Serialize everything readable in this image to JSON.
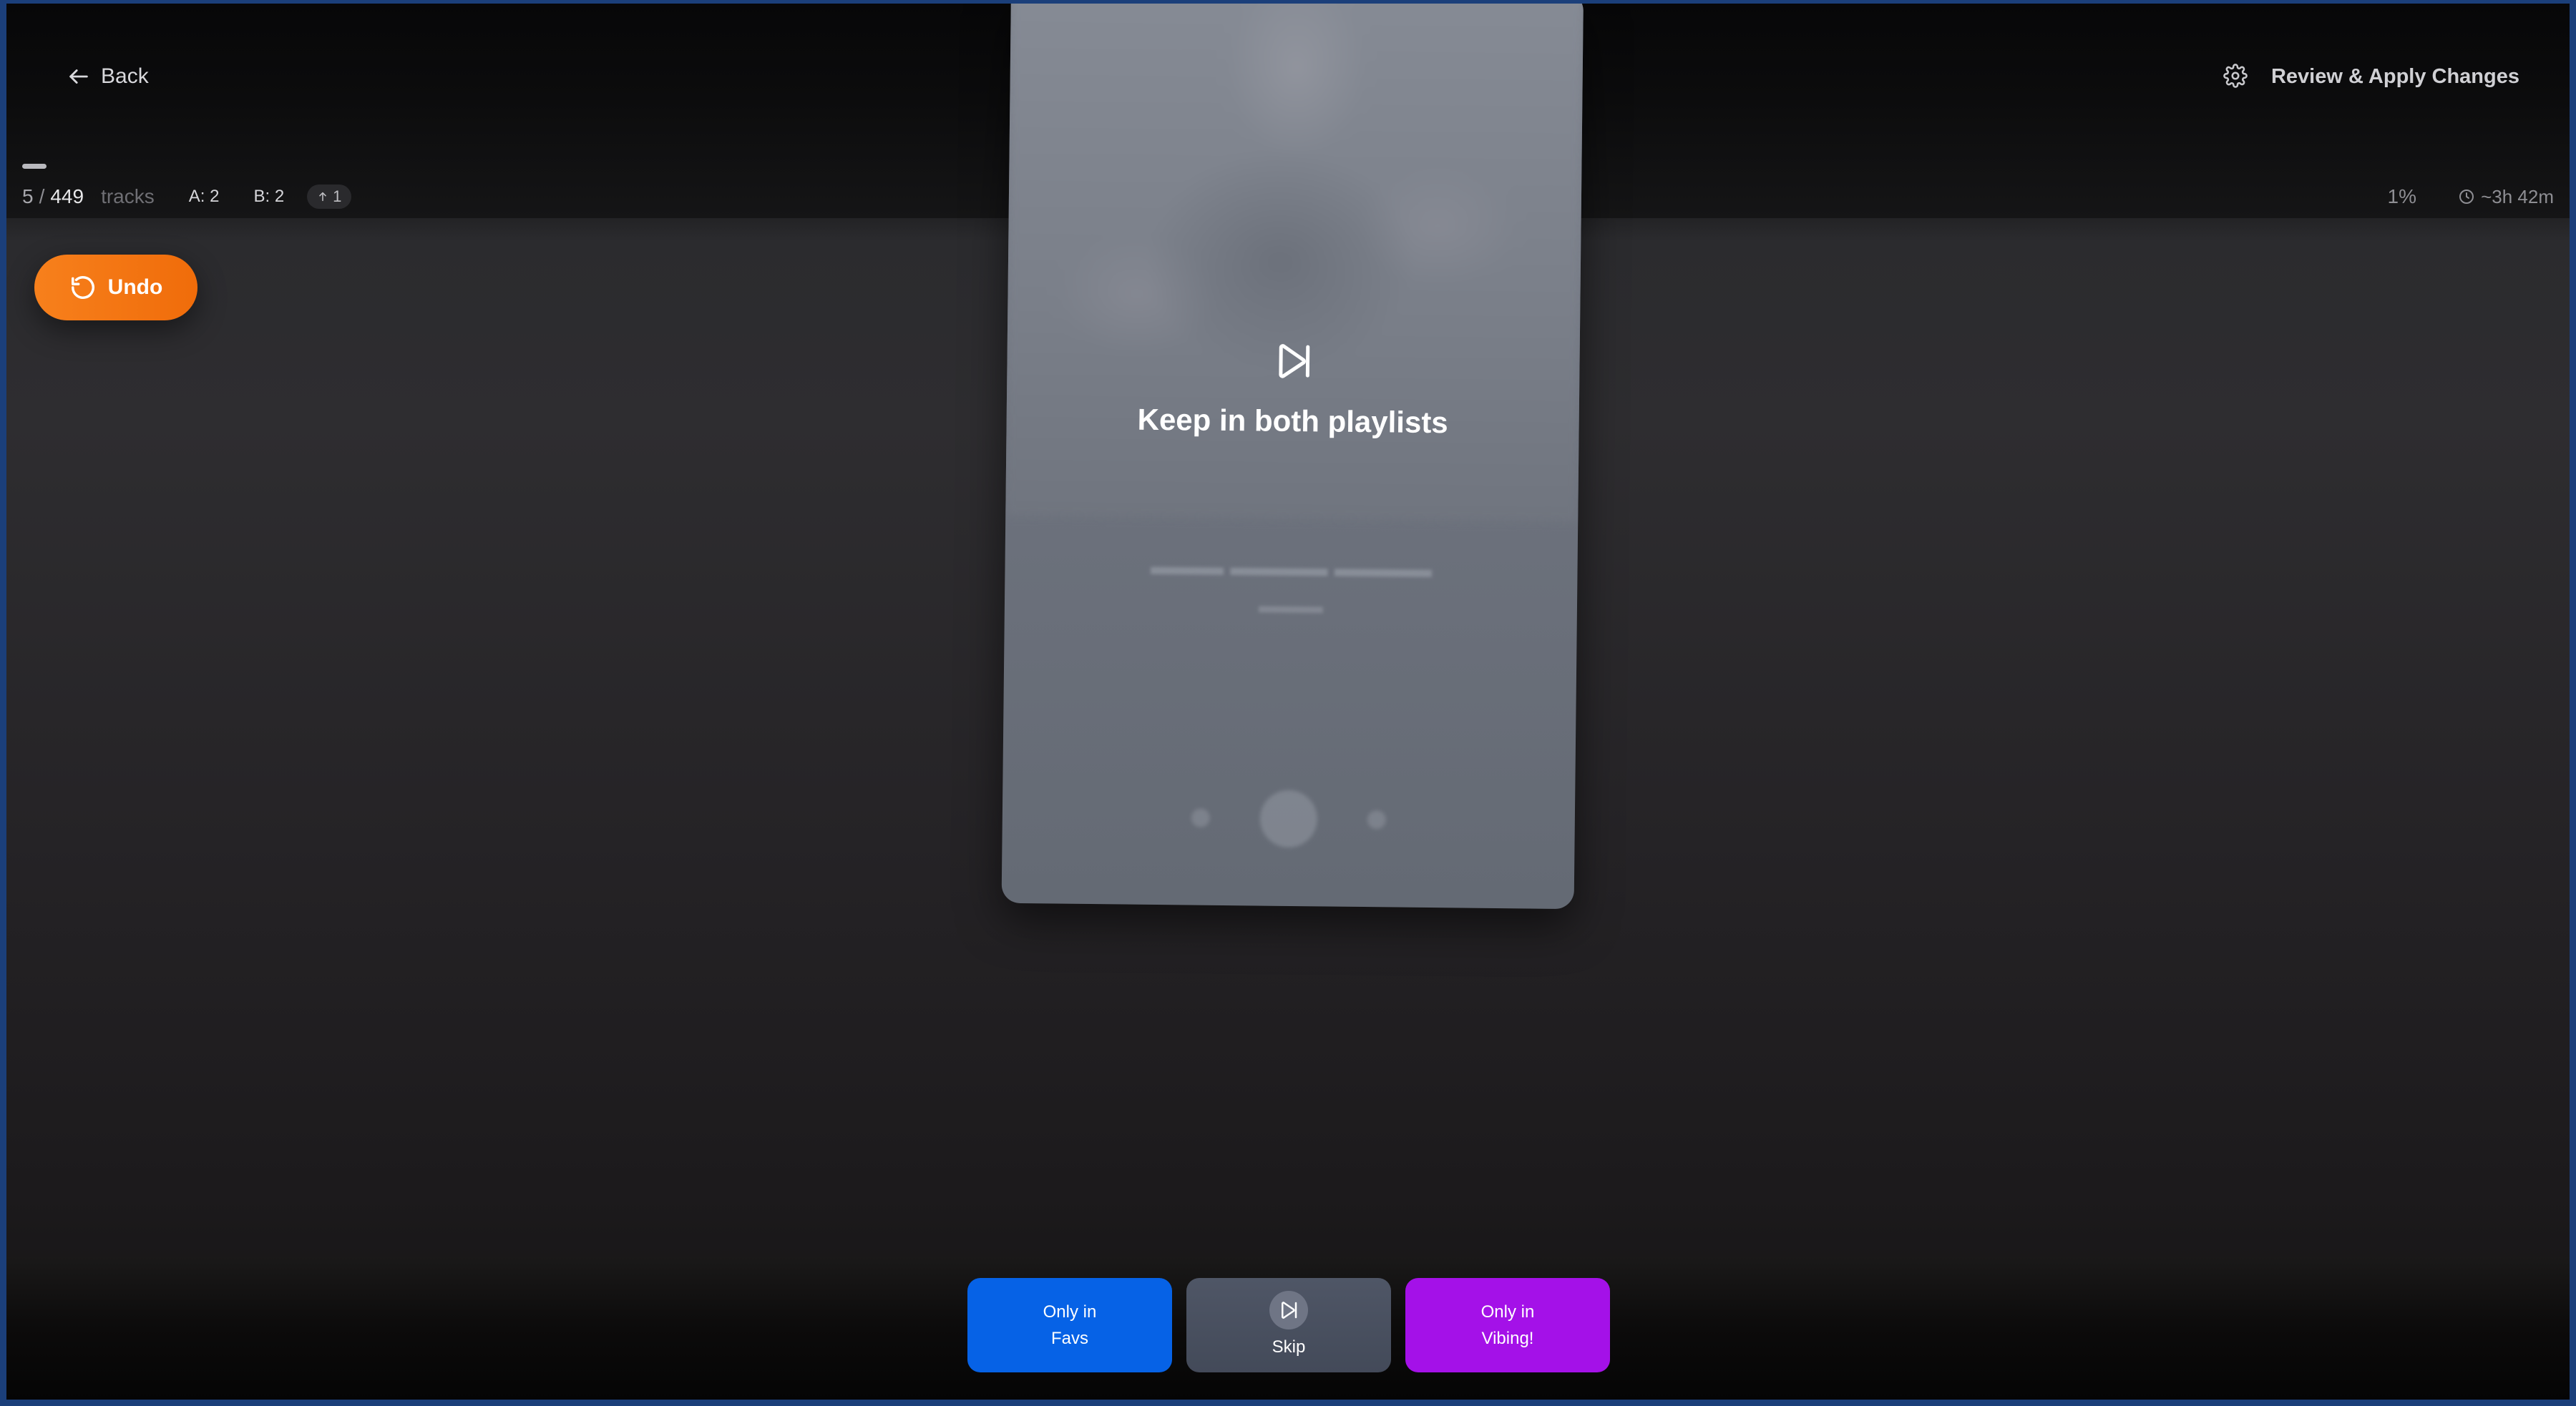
{
  "header": {
    "back_label": "Back",
    "review_label": "Review & Apply Changes"
  },
  "progress": {
    "current": "5",
    "separator": "/",
    "total": "449",
    "unit": "tracks",
    "count_a": "A: 2",
    "count_b": "B: 2",
    "up_count": "1",
    "percent": "1%",
    "eta": "~3h 42m",
    "fraction": 0.011
  },
  "undo": {
    "label": "Undo"
  },
  "card": {
    "overlay_label": "Keep in both playlists",
    "overlay_icon": "skip-forward-icon"
  },
  "actions": {
    "left_line1": "Only in",
    "left_line2": "Favs",
    "skip_label": "Skip",
    "right_line1": "Only in",
    "right_line2": "Vibing!"
  },
  "colors": {
    "undo": "#f7801c",
    "favs": "#0662e6",
    "skip": "#4f5666",
    "vibing": "#a411e8"
  }
}
